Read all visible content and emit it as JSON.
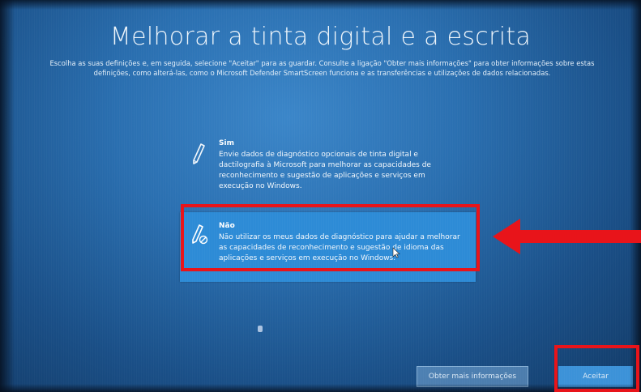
{
  "header": {
    "title": "Melhorar a tinta digital e a escrita",
    "subtitle": "Escolha as suas definições e, em seguida, selecione \"Aceitar\" para as guardar. Consulte a ligação \"Obter mais informações\" para obter informações sobre estas definições, como alterá-las, como o Microsoft Defender SmartScreen funciona e as transferências e utilizações de dados relacionadas."
  },
  "options": [
    {
      "title": "Sim",
      "description": "Envie dados de diagnóstico opcionais de tinta digital e dactilografia à Microsoft para melhorar as capacidades de reconhecimento e sugestão de aplicações e serviços em execução no Windows.",
      "icon": "pen-icon",
      "selected": false
    },
    {
      "title": "Não",
      "description": "Não utilizar os meus dados de diagnóstico para ajudar a melhorar as capacidades de reconhecimento e sugestão de idioma das aplicações e serviços em execução no Windows.",
      "icon": "pen-disabled-icon",
      "selected": true
    }
  ],
  "buttons": {
    "more_info": "Obter mais informações",
    "accept": "Aceitar"
  },
  "annotations": {
    "highlight_color": "#e8141a",
    "arrow_icon": "red-arrow-left-icon"
  },
  "colors": {
    "background": "#2a6fb0",
    "selected_option": "#2d8bd6",
    "accept_button": "#3c92d8"
  }
}
